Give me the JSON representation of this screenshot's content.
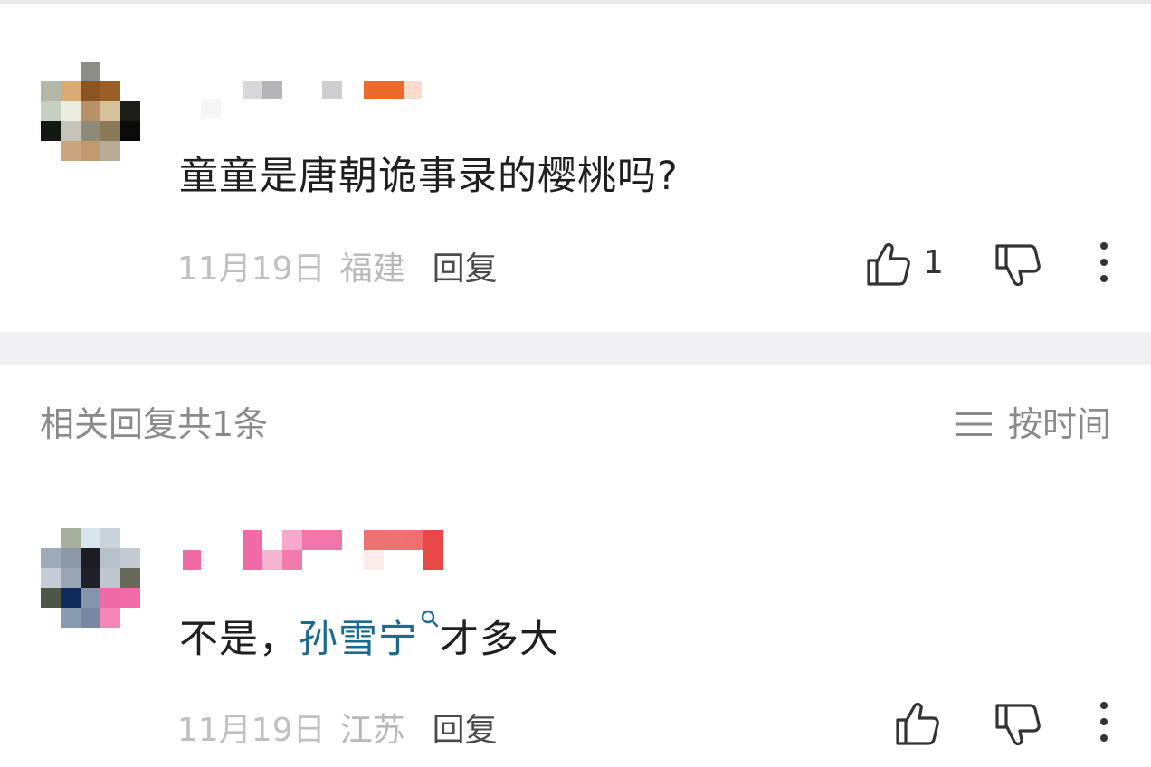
{
  "comment1": {
    "avatar": "blurred-avatar",
    "username": "",
    "text": "童童是唐朝诡事录的樱桃吗?",
    "date": "11月19日",
    "location": "福建",
    "reply_label": "回复",
    "like_count": "1",
    "icons": {
      "like": "thumbs-up-icon",
      "dislike": "thumbs-down-icon",
      "more": "more-vertical-icon"
    }
  },
  "replies_header": {
    "title": "相关回复共1条",
    "sort_label": "按时间",
    "sort_icon": "sort-lines-icon"
  },
  "comment2": {
    "avatar": "blurred-avatar",
    "username": "",
    "text_before": "不是，",
    "mention": "孙雪宁",
    "text_after": "才多大",
    "date": "11月19日",
    "location": "江苏",
    "reply_label": "回复",
    "icons": {
      "like": "thumbs-up-icon",
      "dislike": "thumbs-down-icon",
      "more": "more-vertical-icon",
      "mention": "search-icon"
    }
  },
  "colors": {
    "mention": "#1c6a8f",
    "meta": "#c0c0c4",
    "divider": "#f1f1f3"
  }
}
